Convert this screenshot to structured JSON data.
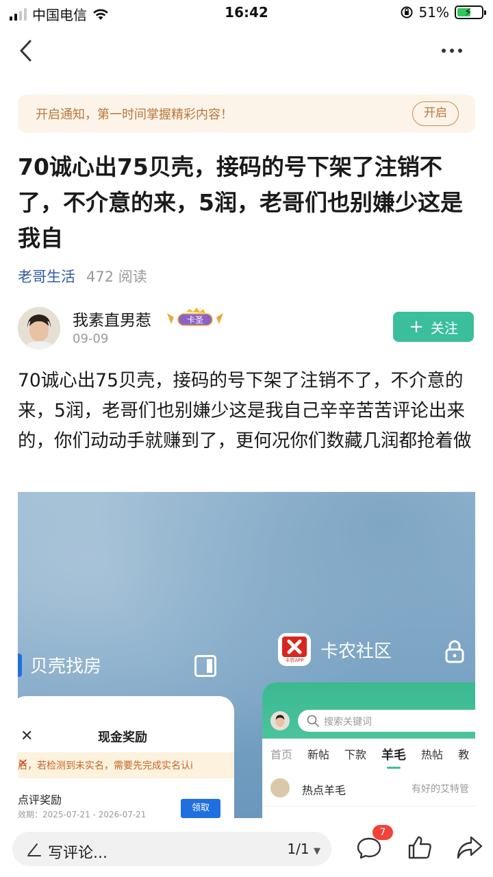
{
  "status_bar": {
    "carrier": "中国电信",
    "time": "16:42",
    "battery": "51%"
  },
  "notice": {
    "text": "开启通知，第一时间掌握精彩内容！",
    "button": "开启"
  },
  "post": {
    "title": "70诚心出75贝壳，接码的号下架了注销不了，不介意的来，5润，老哥们也别嫌少这是我自",
    "category": "老哥生活",
    "reads": "472 阅读",
    "author": {
      "name": "我素直男惹",
      "badge": "卡圣",
      "date": "09-09"
    },
    "follow_button": "关注",
    "body": "70诚心出75贝壳，接码的号下架了注销不了，不介意的来，5润，老哥们也别嫌少这是我自己辛辛苦苦评论出来的，你们动动手就赚到了，更何况你们数藏几润都抢着做"
  },
  "screenshot": {
    "left_app": {
      "name": "贝壳找房",
      "title": "现金奖励",
      "warning": "后，若检测到未实名，需要先完成实名认i",
      "item": "点评奖励",
      "date": "效期：2025-07-21 - 2026-07-21",
      "button": "领取"
    },
    "right_app": {
      "name": "卡农社区",
      "icon_label": "卡农APP",
      "search_placeholder": "搜索关键词",
      "tabs": [
        "首页",
        "新帖",
        "下款",
        "羊毛",
        "热帖",
        "教"
      ],
      "active_tab": "羊毛",
      "row_label": "热点羊毛",
      "row_sub": "有好的艾特管"
    }
  },
  "bottom_bar": {
    "comment_placeholder": "写评论...",
    "page": "1/1",
    "comment_count": "7"
  }
}
